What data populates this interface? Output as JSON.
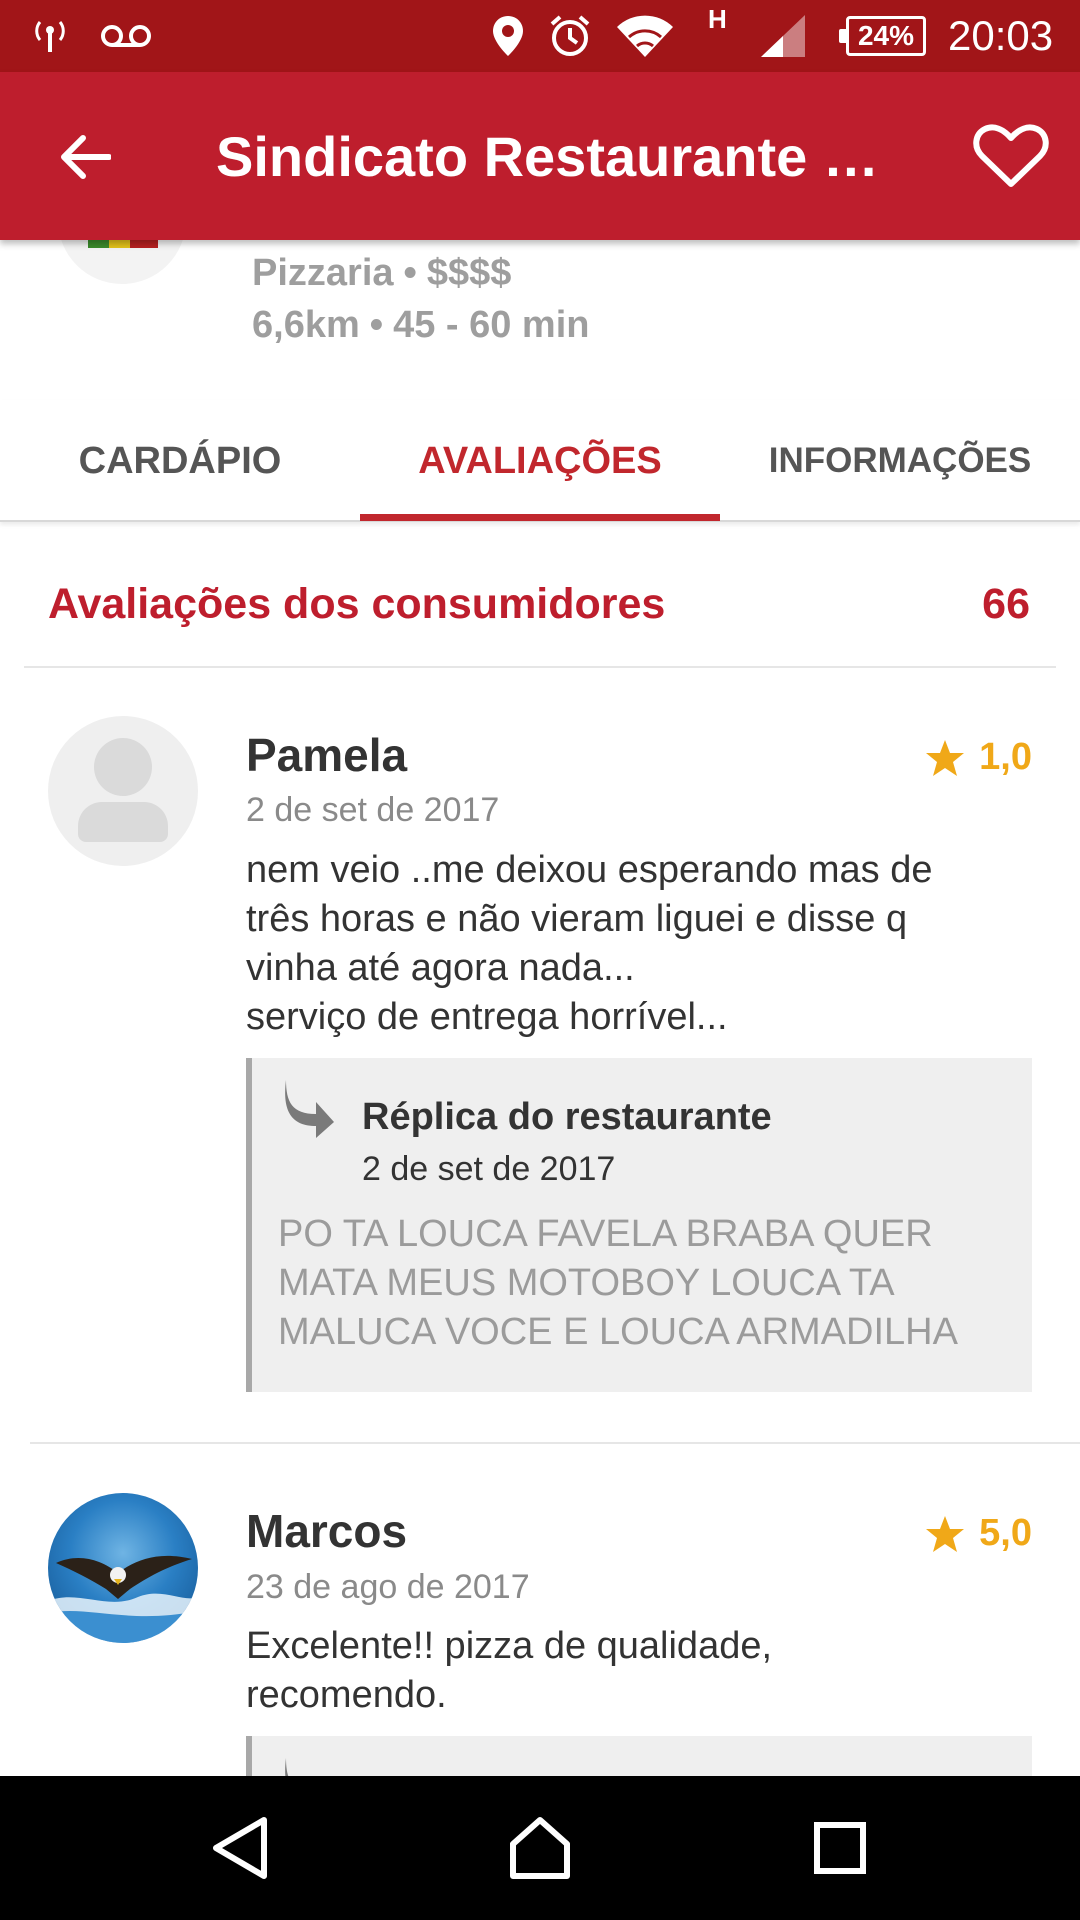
{
  "status_bar": {
    "battery": "24%",
    "time": "20:03",
    "network_label": "H",
    "icons": [
      "antenna-icon",
      "voicemail-icon",
      "location-icon",
      "alarm-icon",
      "wifi-icon",
      "signal-icon",
      "battery-icon"
    ]
  },
  "app_bar": {
    "title": "Sindicato Restaurante E…",
    "icons": [
      "back-arrow-icon",
      "heart-icon"
    ]
  },
  "restaurant": {
    "category": "Pizzaria",
    "price": "$$$$",
    "distance": "6,6km",
    "delivery_time": "45 - 60 min",
    "separator": "•"
  },
  "tabs": [
    {
      "label": "CARDÁPIO",
      "active": false
    },
    {
      "label": "AVALIAÇÕES",
      "active": true
    },
    {
      "label": "INFORMAÇÕES",
      "active": false
    }
  ],
  "reviews_header": {
    "title": "Avaliações dos consumidores",
    "count": "66"
  },
  "reviews": [
    {
      "name": "Pamela",
      "date": "2 de set de 2017",
      "rating": "1,0",
      "text": "nem veio ..me deixou esperando mas de\ntrês horas e não vieram liguei e disse q\nvinha até agora nada...\nserviço de entrega horrível...",
      "reply": {
        "title": "Réplica do restaurante",
        "date": "2 de set de 2017",
        "text": "PO TA LOUCA FAVELA BRABA QUER MATA MEUS MOTOBOY LOUCA TA MALUCA VOCE E LOUCA ARMADILHA"
      }
    },
    {
      "name": "Marcos",
      "date": "23 de ago de 2017",
      "rating": "5,0",
      "text": "Excelente!! pizza de qualidade,\nrecomendo."
    }
  ],
  "colors": {
    "status_bar": "#a11518",
    "app_bar": "#be1e2d",
    "accent": "#c1272d",
    "star": "#f0a818"
  }
}
